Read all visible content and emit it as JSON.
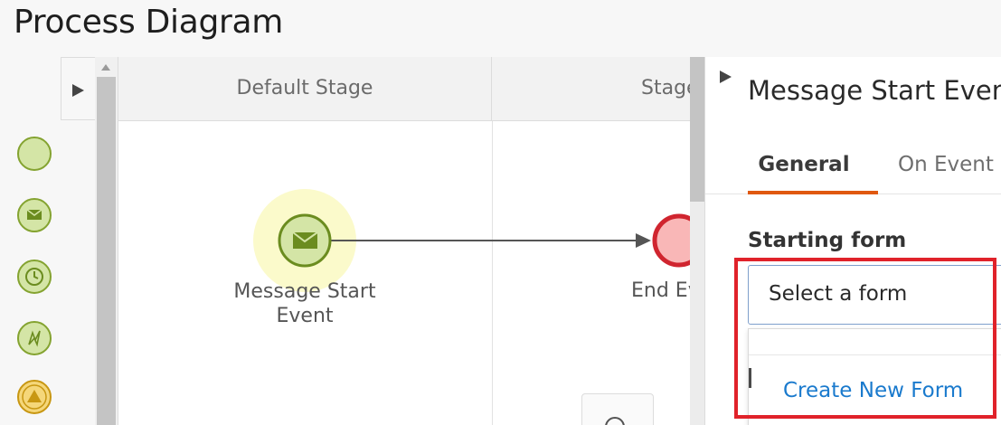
{
  "page": {
    "title": "Process Diagram"
  },
  "palette": {
    "items": [
      {
        "name": "start-event",
        "icon": "circle-icon"
      },
      {
        "name": "message-start-event",
        "icon": "envelope-icon"
      },
      {
        "name": "timer-start-event",
        "icon": "clock-icon"
      },
      {
        "name": "signal-start-event",
        "icon": "lightning-icon"
      },
      {
        "name": "escalation-event",
        "icon": "triangle-icon"
      }
    ]
  },
  "canvas": {
    "stages": [
      {
        "label": "Default Stage"
      },
      {
        "label": "Stage"
      }
    ],
    "nodes": {
      "message_start": {
        "label_line1": "Message Start",
        "label_line2": "Event",
        "icon": "envelope-icon"
      },
      "end_event": {
        "label": "End Ev"
      }
    }
  },
  "panel": {
    "title": "Message Start Event",
    "tabs": [
      {
        "label": "General",
        "active": true
      },
      {
        "label": "On Event"
      }
    ],
    "starting_form": {
      "label": "Starting form",
      "value": "Select a form",
      "options": [
        "Create New Form"
      ]
    }
  },
  "colors": {
    "accent_tab": "#e0580f",
    "highlight": "#e0222a",
    "link": "#1a7acd",
    "event_fill": "#d4e5a6",
    "event_stroke": "#84a330",
    "end_event_stroke": "#d0252f"
  }
}
